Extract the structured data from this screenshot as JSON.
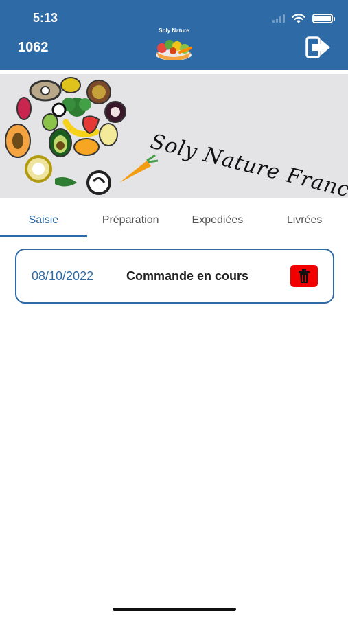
{
  "status_bar": {
    "time": "5:13"
  },
  "header": {
    "user_id": "1062",
    "app_title": "Soly Nature",
    "logo_icon": "vegetable-basket-icon",
    "logout_icon": "logout-arrow-icon",
    "color": "#2d6aa6"
  },
  "banner": {
    "brand_text": "Soly Nature France",
    "illustration": "fruits-and-vegetables-icon"
  },
  "tabs": [
    {
      "label": "Saisie",
      "active": true
    },
    {
      "label": "Préparation",
      "active": false
    },
    {
      "label": "Expediées",
      "active": false
    },
    {
      "label": "Livrées",
      "active": false
    }
  ],
  "orders": [
    {
      "date": "08/10/2022",
      "status": "Commande en cours",
      "delete_icon": "trash-icon",
      "delete_color": "#f20000"
    }
  ]
}
